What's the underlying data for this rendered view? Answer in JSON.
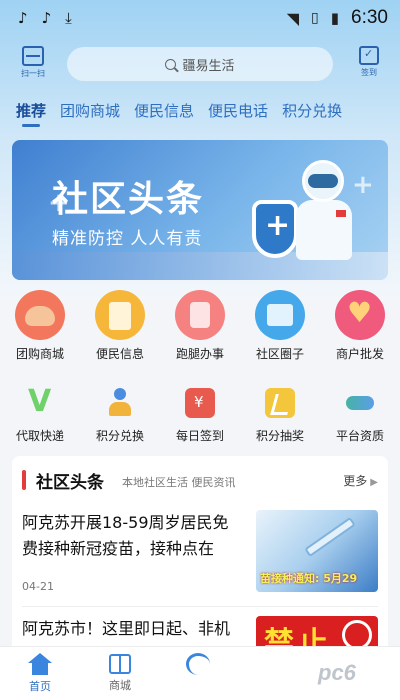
{
  "status_bar": {
    "time": "6:30"
  },
  "header": {
    "scan_label": "扫一扫",
    "search_placeholder": "疆易生活",
    "signin_label": "签到"
  },
  "tabs": [
    {
      "label": "推荐",
      "active": true
    },
    {
      "label": "团购商城"
    },
    {
      "label": "便民信息"
    },
    {
      "label": "便民电话"
    },
    {
      "label": "积分兑换"
    }
  ],
  "banner": {
    "title": "社区头条",
    "subtitle": "精准防控 人人有责"
  },
  "grid_row1": [
    {
      "label": "团购商城",
      "icon": "chicken-icon"
    },
    {
      "label": "便民信息",
      "icon": "shopping-bag-icon"
    },
    {
      "label": "跑腿办事",
      "icon": "errand-icon"
    },
    {
      "label": "社区圈子",
      "icon": "shop-icon"
    },
    {
      "label": "商户批发",
      "icon": "heart-icon"
    }
  ],
  "grid_row2": [
    {
      "label": "代取快递",
      "icon": "v-icon"
    },
    {
      "label": "积分兑换",
      "icon": "person-icon"
    },
    {
      "label": "每日签到",
      "icon": "red-envelope-icon"
    },
    {
      "label": "积分抽奖",
      "icon": "note-icon"
    },
    {
      "label": "平台资质",
      "icon": "handshake-icon"
    }
  ],
  "news": {
    "title": "社区头条",
    "subtitle": "本地社区生活 便民资讯",
    "more": "更多",
    "articles": [
      {
        "line1": "阿克苏开展18-59周岁居民免",
        "line2": "费接种新冠疫苗，接种点在",
        "date": "04-21",
        "thumb_caption": "苗接种通知: 5月29"
      },
      {
        "line1": "阿克苏市！这里即日起、非机",
        "thumb_text": "禁止"
      }
    ]
  },
  "bottom_nav": [
    {
      "label": "首页",
      "active": true
    },
    {
      "label": "商城"
    },
    {
      "label": ""
    }
  ],
  "watermark": "pc6"
}
